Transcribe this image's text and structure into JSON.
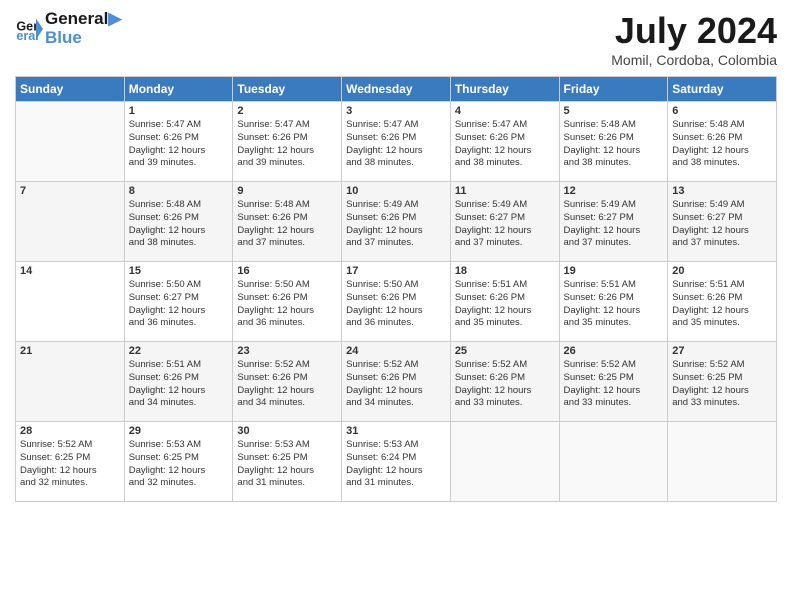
{
  "header": {
    "logo_line1": "General",
    "logo_line2": "Blue",
    "month_title": "July 2024",
    "location": "Momil, Cordoba, Colombia"
  },
  "days_of_week": [
    "Sunday",
    "Monday",
    "Tuesday",
    "Wednesday",
    "Thursday",
    "Friday",
    "Saturday"
  ],
  "weeks": [
    [
      {
        "day": "",
        "info": ""
      },
      {
        "day": "1",
        "info": "Sunrise: 5:47 AM\nSunset: 6:26 PM\nDaylight: 12 hours\nand 39 minutes."
      },
      {
        "day": "2",
        "info": "Sunrise: 5:47 AM\nSunset: 6:26 PM\nDaylight: 12 hours\nand 39 minutes."
      },
      {
        "day": "3",
        "info": "Sunrise: 5:47 AM\nSunset: 6:26 PM\nDaylight: 12 hours\nand 38 minutes."
      },
      {
        "day": "4",
        "info": "Sunrise: 5:47 AM\nSunset: 6:26 PM\nDaylight: 12 hours\nand 38 minutes."
      },
      {
        "day": "5",
        "info": "Sunrise: 5:48 AM\nSunset: 6:26 PM\nDaylight: 12 hours\nand 38 minutes."
      },
      {
        "day": "6",
        "info": "Sunrise: 5:48 AM\nSunset: 6:26 PM\nDaylight: 12 hours\nand 38 minutes."
      }
    ],
    [
      {
        "day": "7",
        "info": ""
      },
      {
        "day": "8",
        "info": "Sunrise: 5:48 AM\nSunset: 6:26 PM\nDaylight: 12 hours\nand 38 minutes."
      },
      {
        "day": "9",
        "info": "Sunrise: 5:48 AM\nSunset: 6:26 PM\nDaylight: 12 hours\nand 37 minutes."
      },
      {
        "day": "10",
        "info": "Sunrise: 5:49 AM\nSunset: 6:26 PM\nDaylight: 12 hours\nand 37 minutes."
      },
      {
        "day": "11",
        "info": "Sunrise: 5:49 AM\nSunset: 6:27 PM\nDaylight: 12 hours\nand 37 minutes."
      },
      {
        "day": "12",
        "info": "Sunrise: 5:49 AM\nSunset: 6:27 PM\nDaylight: 12 hours\nand 37 minutes."
      },
      {
        "day": "13",
        "info": "Sunrise: 5:49 AM\nSunset: 6:27 PM\nDaylight: 12 hours\nand 37 minutes."
      }
    ],
    [
      {
        "day": "14",
        "info": ""
      },
      {
        "day": "15",
        "info": "Sunrise: 5:50 AM\nSunset: 6:27 PM\nDaylight: 12 hours\nand 36 minutes."
      },
      {
        "day": "16",
        "info": "Sunrise: 5:50 AM\nSunset: 6:26 PM\nDaylight: 12 hours\nand 36 minutes."
      },
      {
        "day": "17",
        "info": "Sunrise: 5:50 AM\nSunset: 6:26 PM\nDaylight: 12 hours\nand 36 minutes."
      },
      {
        "day": "18",
        "info": "Sunrise: 5:51 AM\nSunset: 6:26 PM\nDaylight: 12 hours\nand 35 minutes."
      },
      {
        "day": "19",
        "info": "Sunrise: 5:51 AM\nSunset: 6:26 PM\nDaylight: 12 hours\nand 35 minutes."
      },
      {
        "day": "20",
        "info": "Sunrise: 5:51 AM\nSunset: 6:26 PM\nDaylight: 12 hours\nand 35 minutes."
      }
    ],
    [
      {
        "day": "21",
        "info": ""
      },
      {
        "day": "22",
        "info": "Sunrise: 5:51 AM\nSunset: 6:26 PM\nDaylight: 12 hours\nand 34 minutes."
      },
      {
        "day": "23",
        "info": "Sunrise: 5:52 AM\nSunset: 6:26 PM\nDaylight: 12 hours\nand 34 minutes."
      },
      {
        "day": "24",
        "info": "Sunrise: 5:52 AM\nSunset: 6:26 PM\nDaylight: 12 hours\nand 34 minutes."
      },
      {
        "day": "25",
        "info": "Sunrise: 5:52 AM\nSunset: 6:26 PM\nDaylight: 12 hours\nand 33 minutes."
      },
      {
        "day": "26",
        "info": "Sunrise: 5:52 AM\nSunset: 6:25 PM\nDaylight: 12 hours\nand 33 minutes."
      },
      {
        "day": "27",
        "info": "Sunrise: 5:52 AM\nSunset: 6:25 PM\nDaylight: 12 hours\nand 33 minutes."
      }
    ],
    [
      {
        "day": "28",
        "info": "Sunrise: 5:52 AM\nSunset: 6:25 PM\nDaylight: 12 hours\nand 32 minutes."
      },
      {
        "day": "29",
        "info": "Sunrise: 5:53 AM\nSunset: 6:25 PM\nDaylight: 12 hours\nand 32 minutes."
      },
      {
        "day": "30",
        "info": "Sunrise: 5:53 AM\nSunset: 6:25 PM\nDaylight: 12 hours\nand 31 minutes."
      },
      {
        "day": "31",
        "info": "Sunrise: 5:53 AM\nSunset: 6:24 PM\nDaylight: 12 hours\nand 31 minutes."
      },
      {
        "day": "",
        "info": ""
      },
      {
        "day": "",
        "info": ""
      },
      {
        "day": "",
        "info": ""
      }
    ]
  ]
}
